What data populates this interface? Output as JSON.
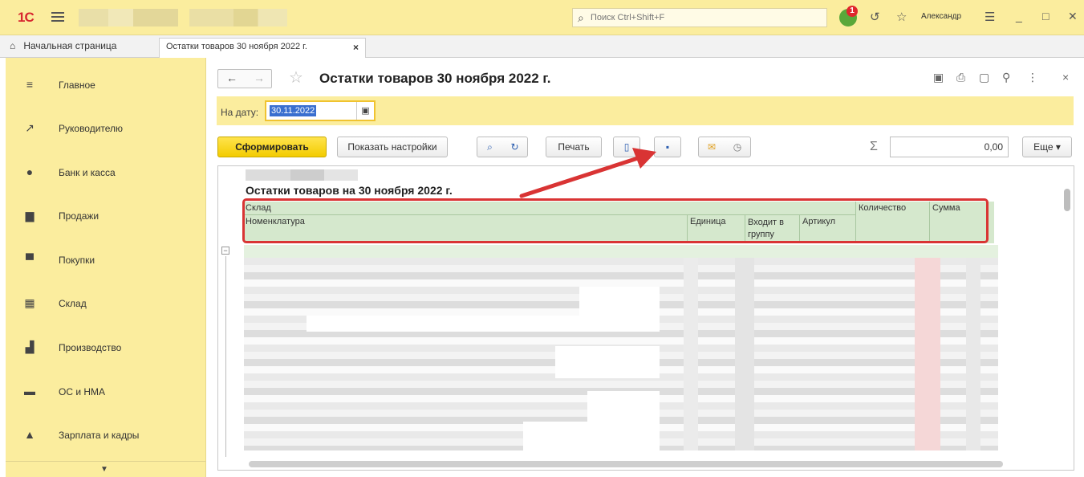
{
  "app": {
    "logo_text": "1С",
    "search_placeholder": "Поиск Ctrl+Shift+F",
    "notification_count": "1",
    "user_name": "Александр"
  },
  "tabs": {
    "home_label": "Начальная страница",
    "active_label": "Остатки товаров 30 ноября 2022 г.",
    "close_glyph": "×"
  },
  "sidebar": {
    "items": [
      {
        "label": "Главное",
        "icon": "menu-icon",
        "glyph": "≡"
      },
      {
        "label": "Руководителю",
        "icon": "trend-icon",
        "glyph": "↗"
      },
      {
        "label": "Банк и касса",
        "icon": "coin-icon",
        "glyph": "●"
      },
      {
        "label": "Продажи",
        "icon": "bag-icon",
        "glyph": "▆"
      },
      {
        "label": "Покупки",
        "icon": "cart-icon",
        "glyph": "▀"
      },
      {
        "label": "Склад",
        "icon": "warehouse-icon",
        "glyph": "▦"
      },
      {
        "label": "Производство",
        "icon": "factory-icon",
        "glyph": "▟"
      },
      {
        "label": "ОС и НМА",
        "icon": "truck-icon",
        "glyph": "▬"
      },
      {
        "label": "Зарплата и кадры",
        "icon": "person-icon",
        "glyph": "▲"
      }
    ],
    "scroll_glyph": "▼"
  },
  "header": {
    "title": "Остатки товаров 30 ноября 2022 г.",
    "back_glyph": "←",
    "forward_glyph": "→",
    "star_glyph": "☆"
  },
  "params": {
    "date_label": "На дату:",
    "date_value": "30.11.2022",
    "calendar_glyph": "▣"
  },
  "toolbar": {
    "generate_label": "Сформировать",
    "settings_label": "Показать настройки",
    "search_glyph": "🔍",
    "search_next_glyph": "↻",
    "print_label": "Печать",
    "preview_glyph": "▯",
    "save_glyph": "▪",
    "mail_glyph": "✉",
    "schedule_glyph": "◷",
    "sum_sign": "Σ",
    "sum_value": "0,00",
    "more_label": "Еще ▾"
  },
  "report": {
    "title": "Остатки товаров на 30 ноября 2022 г.",
    "columns": {
      "warehouse": "Склад",
      "nomenclature": "Номенклатура",
      "unit": "Единица",
      "group": "Входит в группу",
      "article": "Артикул",
      "quantity": "Количество",
      "sum": "Сумма"
    }
  },
  "colors": {
    "accent_yellow": "#fbed9e",
    "primary_button": "#f3cc00",
    "highlight_red": "#d93434",
    "header_green": "#d5e8cd"
  }
}
